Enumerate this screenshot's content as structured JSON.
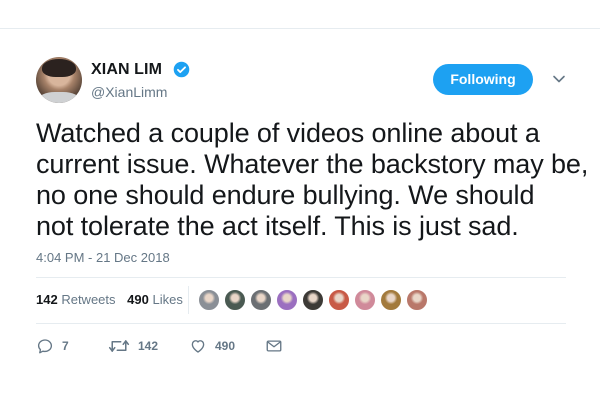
{
  "profile": {
    "display_name": "XIAN LIM",
    "username": "@XianLimm",
    "verified": true,
    "verified_icon": "verified-badge-icon"
  },
  "follow": {
    "label": "Following"
  },
  "tweet": {
    "lines": [
      "Watched a couple of videos online about a",
      "current issue. Whatever the backstory may be,",
      "no one should endure bullying. We should",
      "not tolerate the act itself. This is just sad."
    ],
    "timestamp": "4:04 PM - 21 Dec 2018"
  },
  "stats": {
    "retweets_count": "142",
    "retweets_label": "Retweets",
    "likes_count": "490",
    "likes_label": "Likes"
  },
  "liker_avatars": [
    {
      "color": "#8a8f96"
    },
    {
      "color": "#4a5a52"
    },
    {
      "color": "#6b6f73"
    },
    {
      "color": "#9b6fc0"
    },
    {
      "color": "#3d3a36"
    },
    {
      "color": "#c85a46"
    },
    {
      "color": "#d08a9a"
    },
    {
      "color": "#a37a3c"
    },
    {
      "color": "#b9786a"
    }
  ],
  "actions": {
    "reply_count": "7",
    "retweet_count": "142",
    "like_count": "490"
  },
  "colors": {
    "accent": "#1da1f2",
    "text": "#14171a",
    "muted": "#657786",
    "divider": "#e6ecf0"
  }
}
